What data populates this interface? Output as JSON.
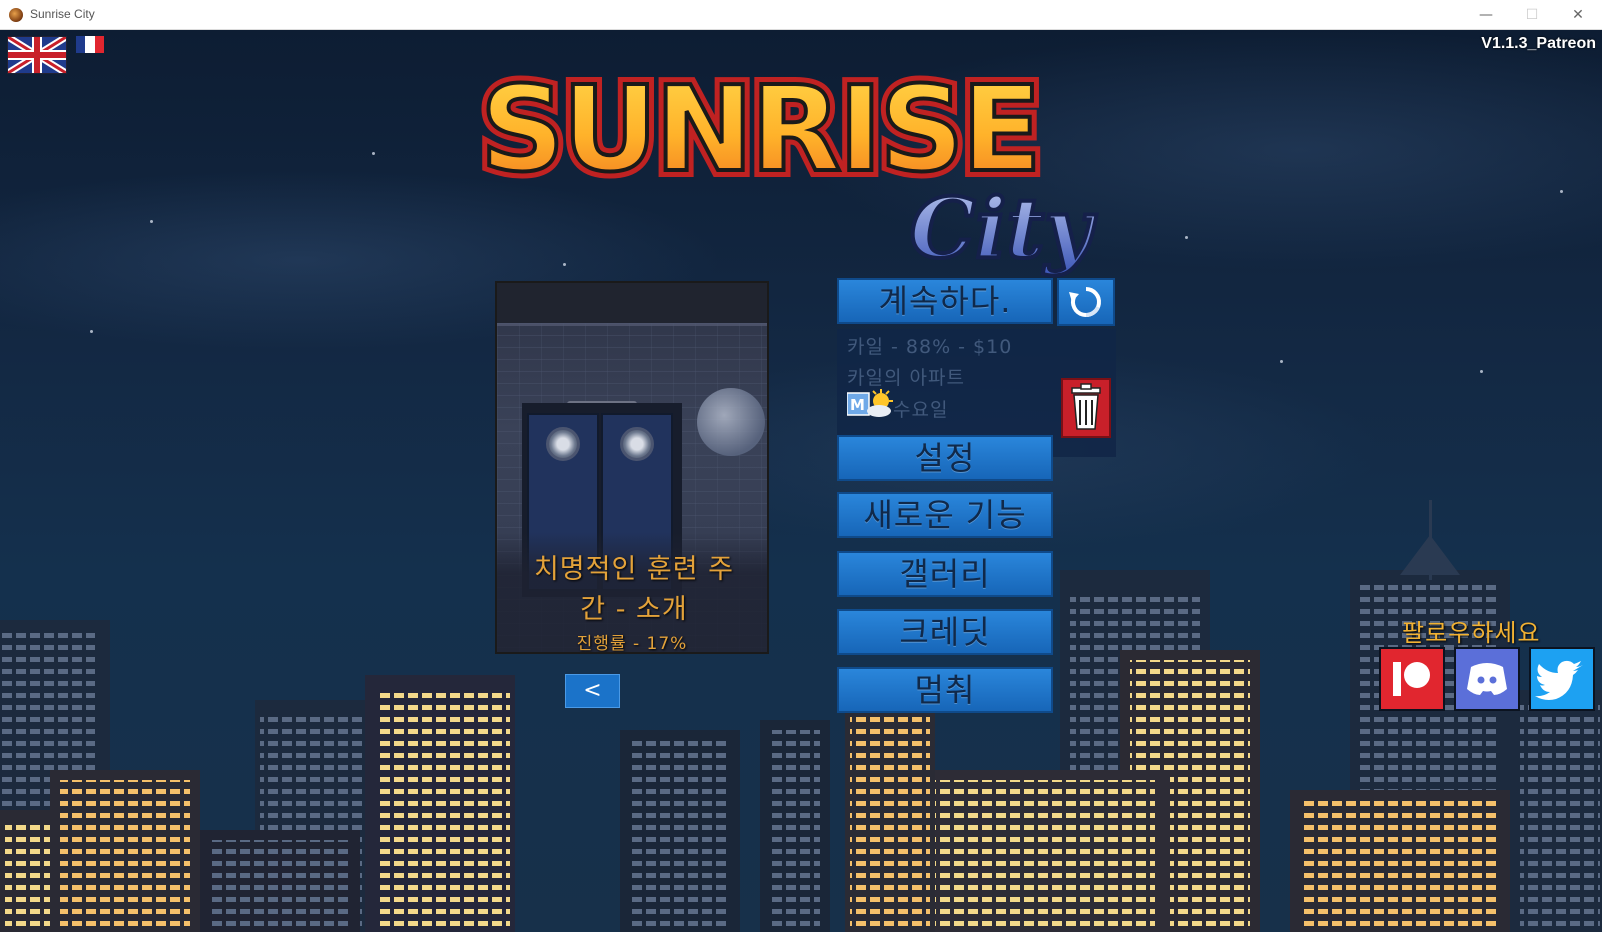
{
  "window": {
    "title": "Sunrise City",
    "minimize": "—",
    "maximize": "☐",
    "close": "✕"
  },
  "version": "V1.1.3_Patreon",
  "languages": [
    "english-flag",
    "french-flag"
  ],
  "logo": {
    "word1": "SUNRISE",
    "word2": "City"
  },
  "preview_card": {
    "title_line1": "치명적인 훈련 주",
    "title_line2": "간 - 소개",
    "progress": "진행률 - 17%",
    "prev_label": "<"
  },
  "menu": {
    "continue": "계속하다.",
    "settings": "설정",
    "new_features": "새로운 기능",
    "gallery": "갤러리",
    "credits": "크레딧",
    "quit": "멈춰"
  },
  "save_slot": {
    "line1": "카일 - 88% - $10",
    "location": "카일의 아파트",
    "weekday_letter": "M",
    "weekday": "수요일"
  },
  "follow": {
    "label": "팔로우하세요",
    "icons": [
      "patreon-icon",
      "discord-icon",
      "twitter-icon"
    ]
  },
  "colors": {
    "button_blue": "#1f78cf",
    "accent_orange": "#e3a23a",
    "delete_red": "#c8202a"
  }
}
